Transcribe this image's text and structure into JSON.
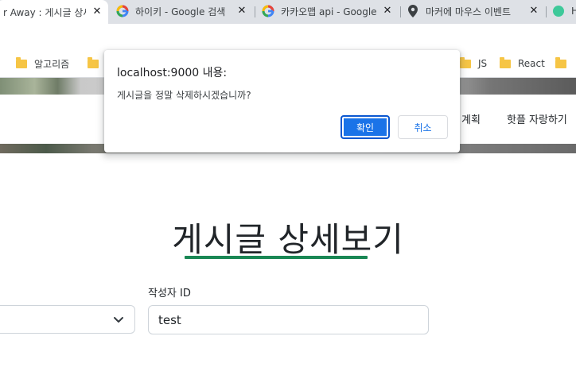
{
  "browser": {
    "tabs": [
      {
        "title": "r Away : 게시글 상세",
        "icon": "generic-page-icon",
        "active": true
      },
      {
        "title": "하이키 - Google 검색",
        "icon": "google-icon",
        "active": false
      },
      {
        "title": "카카오맵 api - Google",
        "icon": "google-icon",
        "active": false
      },
      {
        "title": "마커에 마우스 이벤트",
        "icon": "map-pin-icon",
        "active": false
      },
      {
        "title": "H",
        "icon": "green-site-icon",
        "active": false
      }
    ],
    "bookmarks": [
      {
        "label": "알고리즘",
        "icon": "folder-icon"
      },
      {
        "label": "",
        "icon": "folder-icon"
      },
      {
        "label": "JS",
        "icon": "folder-icon"
      },
      {
        "label": "React",
        "icon": "folder-icon"
      },
      {
        "label": "",
        "icon": "folder-icon"
      }
    ]
  },
  "page": {
    "nav": {
      "item_plan": "계획",
      "item_brag": "핫플 자랑하기"
    },
    "title": "게시글 상세보기",
    "accent_color": "#198754",
    "author_label": "작성자 ID",
    "author_value": "test"
  },
  "dialog": {
    "origin": "localhost:9000 내용:",
    "message": "게시글을 정말 삭제하시겠습니까?",
    "ok_label": "확인",
    "cancel_label": "취소",
    "primary_color": "#1a73e8"
  }
}
